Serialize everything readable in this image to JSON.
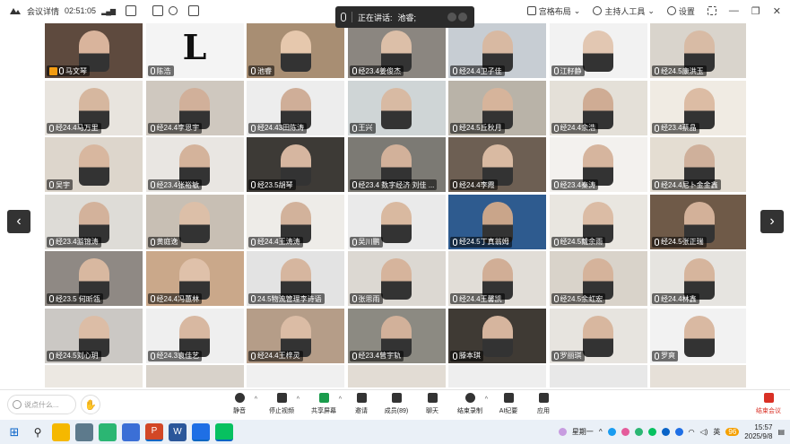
{
  "topbar": {
    "meeting_info": "会议详情",
    "timer": "02:51:05",
    "speaker_label": "正在讲话:",
    "speaker_name": "池睿;",
    "layout": "宫格布局",
    "host_tools": "主持人工具",
    "settings": "设置"
  },
  "tiles": [
    {
      "name": "马文琴",
      "host": true,
      "bg": "#5e4a3e",
      "skin": "#d9b49c"
    },
    {
      "name": "陈浩",
      "logo": "L",
      "bg": "#f4f4f4"
    },
    {
      "name": "池睿",
      "active": true,
      "bg": "#a88e73",
      "skin": "#e6c8ad"
    },
    {
      "name": "经23.4姜俊杰",
      "bg": "#8b8680",
      "skin": "#dcbfa8"
    },
    {
      "name": "经24.4卫子佳",
      "bg": "#c7cdd3",
      "skin": "#d8b9a2"
    },
    {
      "name": "江籽静",
      "bg": "#f2f2f2",
      "skin": "#e2c7b2"
    },
    {
      "name": "经24.5康洪玉",
      "bg": "#d9d4cc",
      "skin": "#d8bba5"
    },
    {
      "name": "经24.4马万里",
      "bg": "#e8e4de",
      "skin": "#d6b79f"
    },
    {
      "name": "经24.4李恩宇",
      "bg": "#cfc8bf",
      "skin": "#d1b09a"
    },
    {
      "name": "经24.43田陈涛",
      "bg": "#ededed",
      "skin": "#cfae98"
    },
    {
      "name": "王兴",
      "bg": "#cfd5d6",
      "skin": "#d8baa3"
    },
    {
      "name": "经24.5丘秋月",
      "bg": "#b9b3a8",
      "skin": "#d6b49b"
    },
    {
      "name": "经24.4余浩",
      "bg": "#e4e0d8",
      "skin": "#cfac94"
    },
    {
      "name": "经23.4蔡晶",
      "bg": "#f0ebe3",
      "skin": "#dcbca4"
    },
    {
      "name": "吴宇",
      "bg": "#ddd6cc",
      "skin": "#d8b79f"
    },
    {
      "name": "经23.4张裕敏",
      "bg": "#e9e6e2",
      "skin": "#d4b39b"
    },
    {
      "name": "经23.5胡琴",
      "bg": "#3d3a36",
      "skin": "#d6b6a0"
    },
    {
      "name": "经23.4 数字经济 刘佳 ...",
      "bg": "#7c7a74",
      "skin": "#d2b19a"
    },
    {
      "name": "经24.4李霞",
      "bg": "#6d5f53",
      "skin": "#d9baa2"
    },
    {
      "name": "经23.4秦涛",
      "bg": "#f3f1ee",
      "skin": "#d6b59e"
    },
    {
      "name": "经24.4尼卜金金鑫",
      "bg": "#e4ddd2",
      "skin": "#cfb09b"
    },
    {
      "name": "经23.4游锦涛",
      "bg": "#dedcd7",
      "skin": "#d3b29b"
    },
    {
      "name": "黄庭逸",
      "bg": "#c8bfb4",
      "skin": "#dcbfa8"
    },
    {
      "name": "经24.4王涛涛",
      "bg": "#eeece8",
      "skin": "#d2b29b"
    },
    {
      "name": "吴川鹏",
      "bg": "#eaeaea",
      "skin": "#d9b9a0"
    },
    {
      "name": "经24.5丁真翁姆",
      "bg": "#2e5b8f",
      "skin": "#c9a58a"
    },
    {
      "name": "经24.5戴余雨",
      "bg": "#e9e6e0",
      "skin": "#dbbca5"
    },
    {
      "name": "经24.5张正瑞",
      "bg": "#6f5a48",
      "skin": "#d3b199"
    },
    {
      "name": "经23.5 何昕瓴",
      "bg": "#8f8984",
      "skin": "#d8b8a0"
    },
    {
      "name": "经24.4冯蕙林",
      "bg": "#caa88a",
      "skin": "#dfc1aa"
    },
    {
      "name": "24.5物流管理李诗语",
      "bg": "#e3e3e3",
      "skin": "#d6b69f"
    },
    {
      "name": "张思雨",
      "bg": "#dcd8d2",
      "skin": "#d6b49c"
    },
    {
      "name": "经24.4王馨凯",
      "bg": "#e1ddd7",
      "skin": "#d1ae96"
    },
    {
      "name": "经24.5余虹宏",
      "bg": "#d9d3ca",
      "skin": "#d5b39b"
    },
    {
      "name": "经24.4林鑫",
      "bg": "#e6e4e0",
      "skin": "#d6b59d"
    },
    {
      "name": "经24.5刘心玥",
      "bg": "#cbc8c4",
      "skin": "#dcbda6"
    },
    {
      "name": "经24.3袁佳艺",
      "bg": "#efefef",
      "skin": "#d8b8a1"
    },
    {
      "name": "经24.4王梓灵",
      "bg": "#b59d88",
      "skin": "#dbbca5"
    },
    {
      "name": "经23.4曾宇轨",
      "bg": "#8c8a82",
      "skin": "#d2b19a"
    },
    {
      "name": "滕本琪",
      "bg": "#3f3a34",
      "skin": "#d6b59e"
    },
    {
      "name": "罗丽琪",
      "bg": "#e7e4df",
      "skin": "#d8b79f"
    },
    {
      "name": "罗爽",
      "bg": "#f2f2f2",
      "skin": "#d9b9a2"
    }
  ],
  "toolbar": {
    "chat_placeholder": "说点什么...",
    "buttons": [
      {
        "label": "静音",
        "name": "mute"
      },
      {
        "label": "停止视频",
        "name": "stop-video"
      },
      {
        "label": "共享屏幕",
        "name": "share-screen"
      },
      {
        "label": "邀请",
        "name": "invite"
      },
      {
        "label": "成员(89)",
        "name": "members"
      },
      {
        "label": "聊天",
        "name": "chat"
      },
      {
        "label": "结束录制",
        "name": "end-recording"
      },
      {
        "label": "AI纪要",
        "name": "ai-notes"
      },
      {
        "label": "应用",
        "name": "apps"
      }
    ],
    "end_meeting": "结束会议"
  },
  "taskbar": {
    "weekday": "星期一",
    "ime": "英",
    "time": "15:57",
    "date": "2025/9/8",
    "notif_count": "96"
  }
}
